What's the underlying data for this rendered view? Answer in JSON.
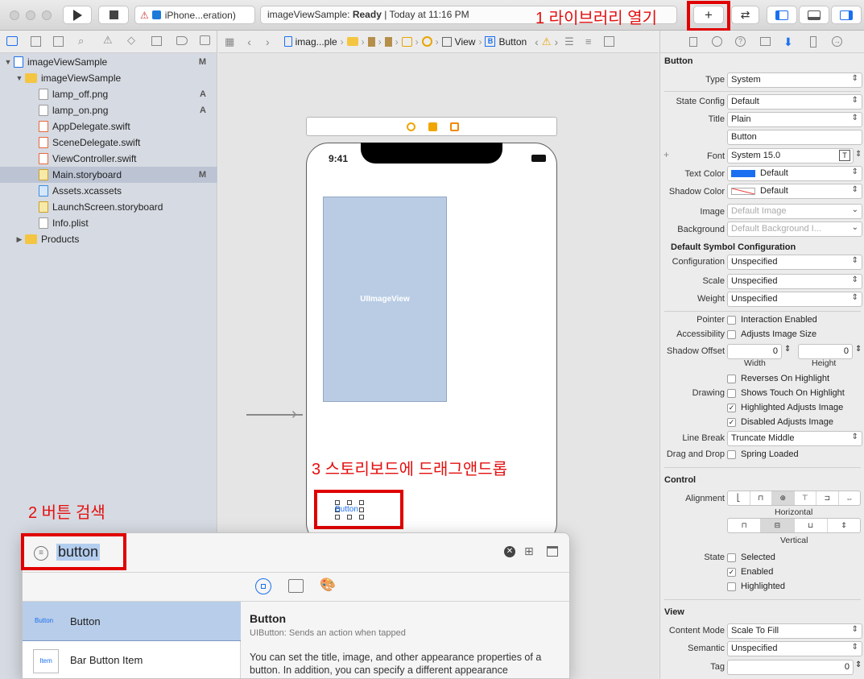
{
  "toolbar": {
    "scheme": "iPhone...eration)",
    "status_app": "imageViewSample: ",
    "status_state": "Ready",
    "status_time": " | Today at 11:16 PM"
  },
  "annotations": {
    "open_library": "1 라이브러리 열기",
    "search_button": "2 버튼 검색",
    "drag_drop": "3 스토리보드에 드래그앤드롭"
  },
  "navigator": {
    "items": [
      {
        "label": "imageViewSample",
        "status": "M"
      },
      {
        "label": "imageViewSample",
        "status": ""
      },
      {
        "label": "lamp_off.png",
        "status": "A"
      },
      {
        "label": "lamp_on.png",
        "status": "A"
      },
      {
        "label": "AppDelegate.swift",
        "status": ""
      },
      {
        "label": "SceneDelegate.swift",
        "status": ""
      },
      {
        "label": "ViewController.swift",
        "status": ""
      },
      {
        "label": "Main.storyboard",
        "status": "M"
      },
      {
        "label": "Assets.xcassets",
        "status": ""
      },
      {
        "label": "LaunchScreen.storyboard",
        "status": ""
      },
      {
        "label": "Info.plist",
        "status": ""
      },
      {
        "label": "Products",
        "status": ""
      }
    ]
  },
  "jumpbar": {
    "project": "imag...ple",
    "view": "View",
    "button": "Button"
  },
  "canvas": {
    "time": "9:41",
    "imageview_label": "UIImageView",
    "button_label": "Button"
  },
  "library": {
    "search_value": "button",
    "results": [
      {
        "thumb": "Button",
        "label": "Button"
      },
      {
        "thumb": "Item",
        "label": "Bar Button Item"
      }
    ],
    "detail_title": "Button",
    "detail_subtitle": "UIButton: Sends an action when tapped",
    "detail_body": "You can set the title, image, and other appearance properties of a button. In addition, you can specify a different appearance"
  },
  "inspector": {
    "button_header": "Button",
    "type_label": "Type",
    "type_value": "System",
    "state_config_label": "State Config",
    "state_config_value": "Default",
    "title_label": "Title",
    "title_value": "Plain",
    "title_text": "Button",
    "font_label": "Font",
    "font_value": "System 15.0",
    "text_color_label": "Text Color",
    "text_color_value": "Default",
    "shadow_color_label": "Shadow Color",
    "shadow_color_value": "Default",
    "image_label": "Image",
    "image_placeholder": "Default Image",
    "background_label": "Background",
    "background_placeholder": "Default Background I...",
    "symbol_header": "Default Symbol Configuration",
    "configuration_label": "Configuration",
    "configuration_value": "Unspecified",
    "scale_label": "Scale",
    "scale_value": "Unspecified",
    "weight_label": "Weight",
    "weight_value": "Unspecified",
    "pointer_label": "Pointer",
    "pointer_value": "Interaction Enabled",
    "accessibility_label": "Accessibility",
    "accessibility_value": "Adjusts Image Size",
    "shadow_offset_label": "Shadow Offset",
    "shadow_width": "0",
    "shadow_height": "0",
    "width_caption": "Width",
    "height_caption": "Height",
    "drawing_label": "Drawing",
    "reverses": "Reverses On Highlight",
    "shows_touch": "Shows Touch On Highlight",
    "highlighted_adjusts": "Highlighted Adjusts Image",
    "disabled_adjusts": "Disabled Adjusts Image",
    "line_break_label": "Line Break",
    "line_break_value": "Truncate Middle",
    "drag_drop_label": "Drag and Drop",
    "spring_loaded": "Spring Loaded",
    "control_header": "Control",
    "alignment_label": "Alignment",
    "horizontal_caption": "Horizontal",
    "vertical_caption": "Vertical",
    "state_label": "State",
    "selected": "Selected",
    "enabled": "Enabled",
    "highlighted": "Highlighted",
    "view_header": "View",
    "content_mode_label": "Content Mode",
    "content_mode_value": "Scale To Fill",
    "semantic_label": "Semantic",
    "semantic_value": "Unspecified",
    "tag_label": "Tag",
    "tag_value": "0"
  },
  "colors": {
    "accent": "#1a6ff0",
    "annotation_red": "#e40f0f",
    "selection": "#bcc4d4"
  }
}
